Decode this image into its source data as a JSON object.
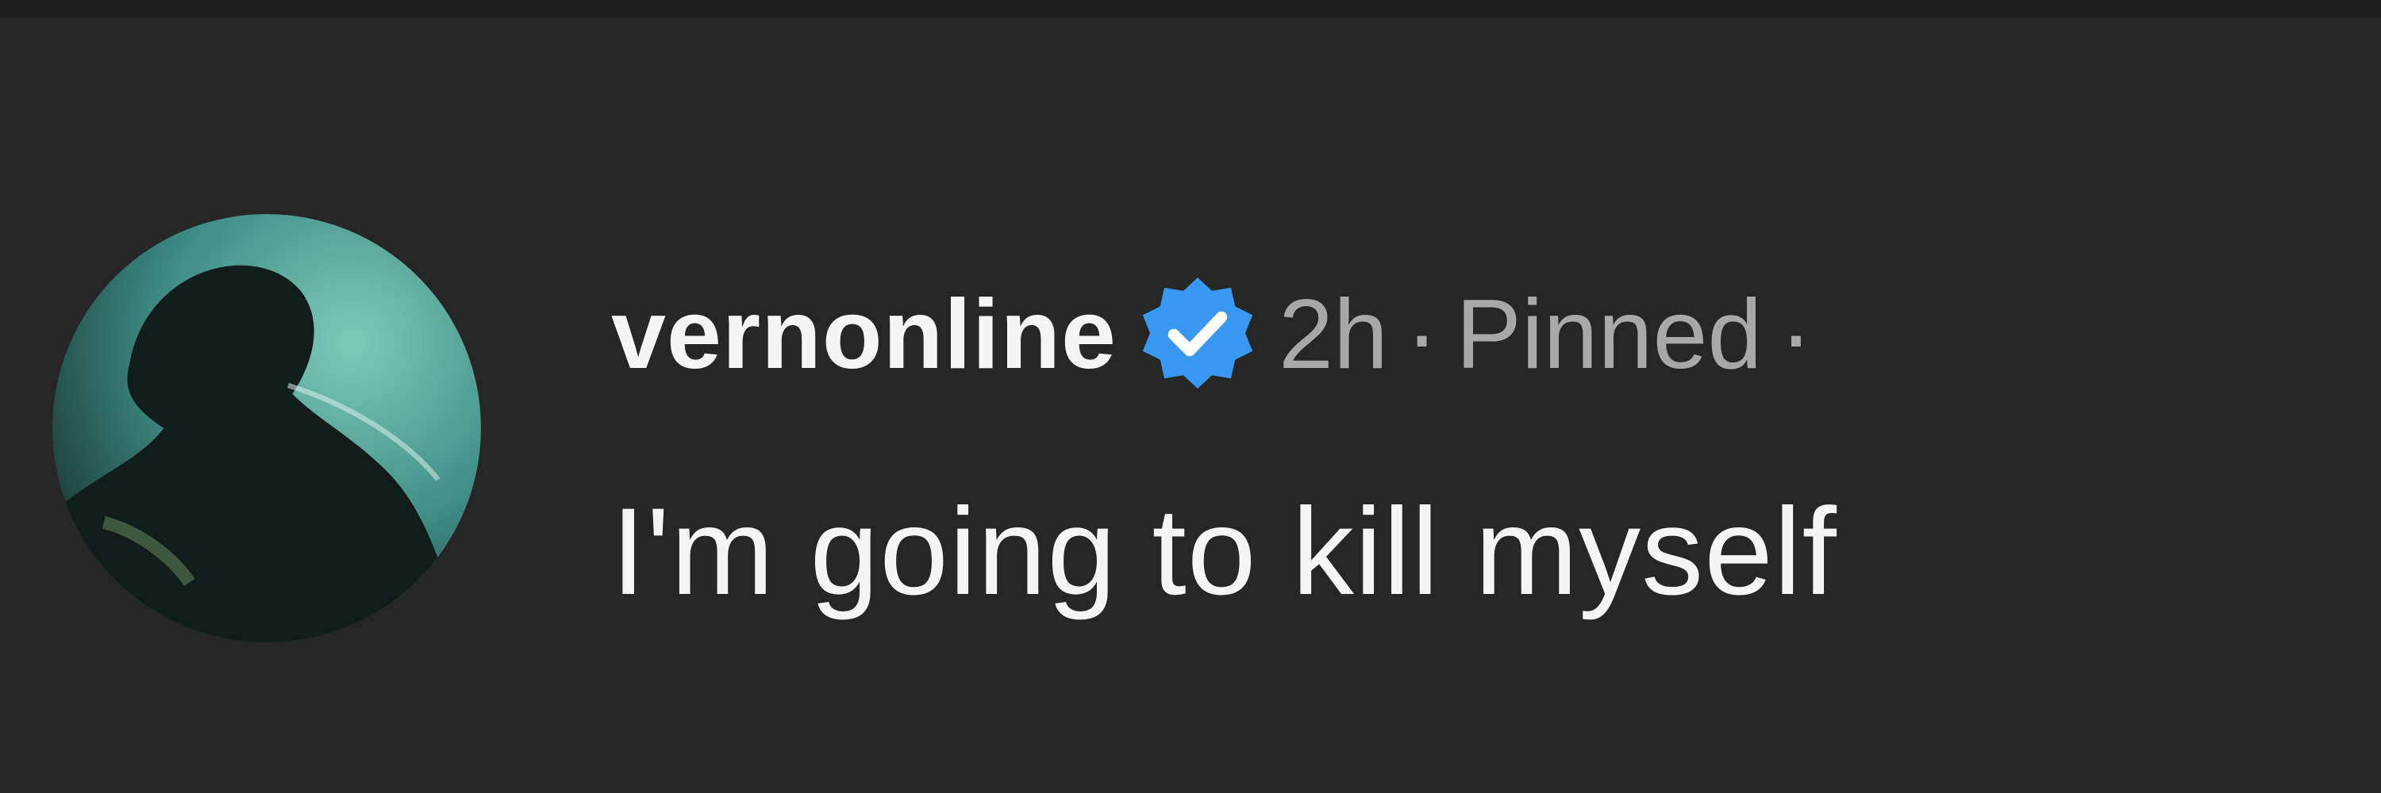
{
  "comment": {
    "username": "vernonline",
    "verified_icon": "verified-badge-icon",
    "time": "2h",
    "separator": "·",
    "pinned_label": "Pinned",
    "text": "I'm going to kill myself"
  },
  "colors": {
    "background": "#262626",
    "username": "#f5f5f5",
    "meta": "#a8a8a8",
    "verified_badge": "#3897f0"
  }
}
